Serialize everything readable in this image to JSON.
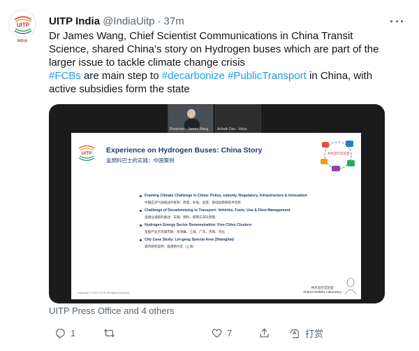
{
  "tweet": {
    "author_name": "UITP India",
    "handle": "@IndiaUitp",
    "separator": "·",
    "time": "37m",
    "avatar_caption": "INDIA",
    "avatar_logo_text": "UITP",
    "text_segments": {
      "line1": "Dr James Wang, Chief Scientist Communications in China Transit",
      "line2": "Science, shared China’s story on Hydrogen buses which are part of the",
      "line3": "larger issue to tackle climate change crisis",
      "tag1": "#FCBs",
      "mid1": " are main step to ",
      "tag2": "#decarbonize",
      "space": " ",
      "tag3": "#PublicTransport",
      "mid2": " in China, with",
      "line5": "active subsidies form the state"
    },
    "retweeted_by": "UITP Press Office and 4 others",
    "actions": {
      "reply_count": "1",
      "retweet_count": "",
      "like_count": "7",
      "translate_label": "打赏"
    }
  },
  "media": {
    "tiles": [
      {
        "label": "Presenter - James Wang"
      },
      {
        "label": "Achuth Das - Volvo"
      }
    ],
    "slide": {
      "logo_text": "UITP",
      "title": "Experience on Hydrogen Buses: China Story",
      "subtitle": "氢燃料巴士的实践：中国案例",
      "badge_label": "共享出行实验室",
      "points": [
        {
          "en": "Framing Climate Challenge in China: Policy, subsidy, Regulatory, Infrastructure & Innovation",
          "cn": "中国应对气候挑战的框架：政策、补贴、监管、基础设施和技术创新"
        },
        {
          "en": "Challenge of Decarbonizing in Transport: Vehicles, Fuels, Use & Fleet Management",
          "cn": "运输业减碳的挑战：车辆、燃料、使用与车队管理"
        },
        {
          "en": "Hydrogen Energy Sector Demonstration: Five Cities Clusters",
          "cn": "氢能产业示范城市群：京津冀、上海、广东、河南、河北"
        },
        {
          "en": "City Case Study: Lin-gang Special Area (Shanghai)",
          "cn": "城市研究案例：临港新片区（上海）"
        }
      ],
      "copyright": "Copyright © 2021 UITP, All rights reserved",
      "lab_cn": "共享出行实验室",
      "lab_en": "Shared Mobility Laboratory"
    }
  },
  "icons": [
    "more-icon",
    "reply-icon",
    "retweet-icon",
    "like-icon",
    "share-icon",
    "translate-icon"
  ],
  "colors": {
    "link": "#1d9bf0",
    "muted": "#536471",
    "text": "#0f1419",
    "slide_title": "#1f3a6b"
  }
}
